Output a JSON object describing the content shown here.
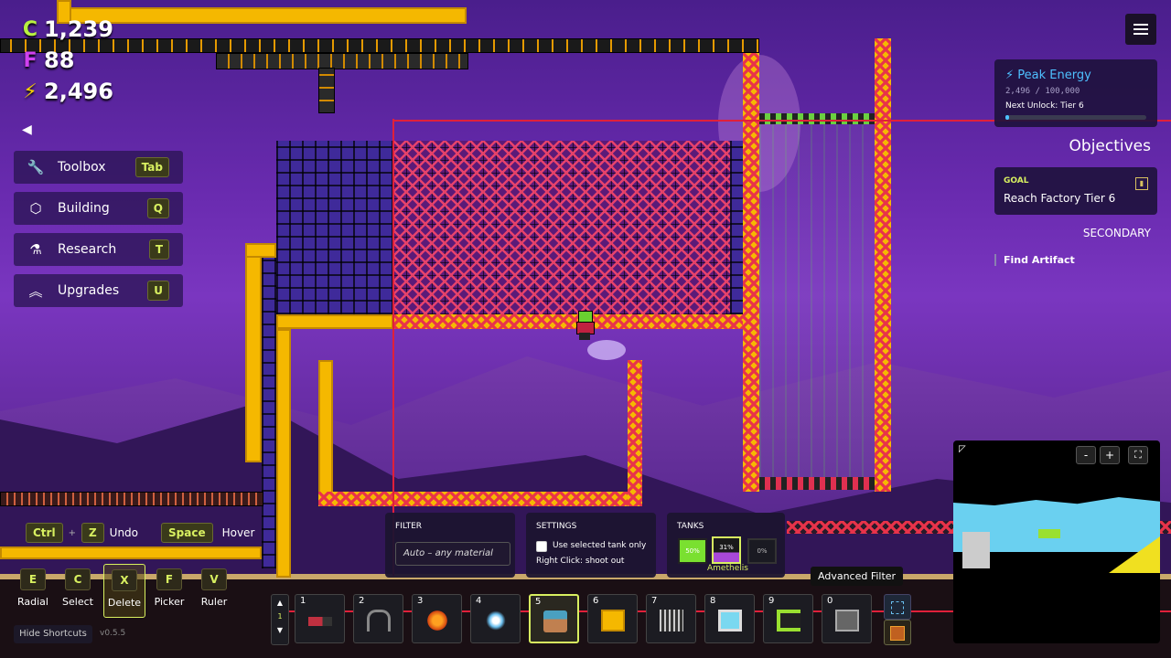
{
  "resources": [
    {
      "icon": "c-credit-icon",
      "value": "1,239",
      "color": "#b8f040"
    },
    {
      "icon": "f-flux-icon",
      "value": "88",
      "color": "#d040f0"
    },
    {
      "icon": "lightning-icon",
      "value": "2,496",
      "color": "#f5d000"
    }
  ],
  "sidebar": {
    "collapse_glyph": "◀",
    "items": [
      {
        "label": "Toolbox",
        "key": "Tab"
      },
      {
        "label": "Building",
        "key": "Q"
      },
      {
        "label": "Research",
        "key": "T"
      },
      {
        "label": "Upgrades",
        "key": "U"
      }
    ]
  },
  "peak_energy": {
    "title": "Peak Energy",
    "progress_text": "2,496 / 100,000",
    "next_unlock": "Next Unlock: Tier 6",
    "progress": 0.025
  },
  "objectives": {
    "heading": "Objectives",
    "goal_label": "GOAL",
    "goal_text": "Reach Factory Tier 6",
    "secondary_label": "SECONDARY",
    "secondary_items": [
      "Find Artifact"
    ]
  },
  "shortcuts_top": {
    "ctrl": "Ctrl",
    "plus": "+",
    "z": "Z",
    "undo": "Undo",
    "space": "Space",
    "hover": "Hover"
  },
  "shortcuts": [
    {
      "key": "E",
      "label": "Radial"
    },
    {
      "key": "C",
      "label": "Select"
    },
    {
      "key": "X",
      "label": "Delete"
    },
    {
      "key": "F",
      "label": "Picker"
    },
    {
      "key": "V",
      "label": "Ruler"
    }
  ],
  "hide_shortcuts": "Hide Shortcuts",
  "version": "v0.5.5",
  "filter": {
    "label": "FILTER",
    "placeholder": "Auto – any material"
  },
  "settings": {
    "label": "SETTINGS",
    "checkbox_label": "Use selected tank only",
    "hint": "Right Click: shoot out"
  },
  "tanks": {
    "label": "TANKS",
    "items": [
      "50%",
      "31%",
      "0%"
    ],
    "selected_name": "Amethelis"
  },
  "tooltip": "Advanced Filter",
  "hotbar": {
    "page_numbers": [
      "1"
    ],
    "slots": [
      {
        "num": "1",
        "icon": "blaster-icon"
      },
      {
        "num": "2",
        "icon": "grabber-icon"
      },
      {
        "num": "3",
        "icon": "fire-tool-icon"
      },
      {
        "num": "4",
        "icon": "spray-tool-icon"
      },
      {
        "num": "5",
        "icon": "pump-tool-icon"
      },
      {
        "num": "6",
        "icon": "yellow-block-icon"
      },
      {
        "num": "7",
        "icon": "grate-icon"
      },
      {
        "num": "8",
        "icon": "screen-icon"
      },
      {
        "num": "9",
        "icon": "conveyor-c-icon"
      },
      {
        "num": "0",
        "icon": "machine-icon"
      }
    ]
  },
  "minimap": {
    "zoom_out": "-",
    "zoom_in": "+",
    "fullscreen": "⛶"
  },
  "colors": {
    "accent": "#d8f060",
    "energy": "#4ec0ff",
    "grid_red": "#e0203a",
    "girder": "#f5b800"
  }
}
